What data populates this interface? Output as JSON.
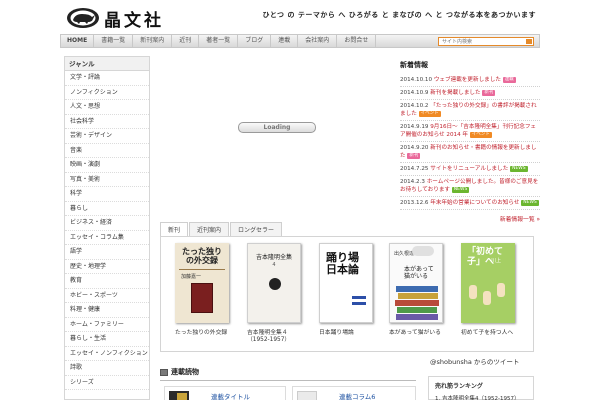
{
  "header": {
    "logo_text": "晶文社",
    "tagline": "ひとつ の テーマから へ ひろがる と まなびの へ と つながる本をあつかいます"
  },
  "nav": {
    "items": [
      "HOME",
      "書籍一覧",
      "新刊案内",
      "近刊",
      "著者一覧",
      "ブログ",
      "連載",
      "会社案内",
      "お問合せ"
    ]
  },
  "search": {
    "placeholder": "サイト内検索"
  },
  "sidebar": {
    "title": "ジャンル",
    "items": [
      "文学・評論",
      "ノンフィクション",
      "人文・思想",
      "社会科学",
      "芸術・デザイン",
      "音楽",
      "映画・演劇",
      "写真・美術",
      "科学",
      "暮らし",
      "ビジネス・経済",
      "エッセイ・コラム集",
      "語学",
      "歴史・地理学",
      "教育",
      "ホビー・スポーツ",
      "料理・健康",
      "ホーム・ファミリー",
      "暮らし・生活",
      "エッセイ・ノンフィクション",
      "詩歌",
      "シリーズ"
    ]
  },
  "slideshow": {
    "loading_label": "Loading"
  },
  "news": {
    "title": "新着情報",
    "items": [
      {
        "date": "2014.10.10",
        "text": "ウェブ連載を更新しました",
        "badge": "連載",
        "badge_style": "pink"
      },
      {
        "date": "2014.10.9",
        "text": "新刊を掲載しました",
        "badge": "新刊",
        "badge_style": "pink"
      },
      {
        "date": "2014.10.2",
        "text": "「たった独りの外交録」の書評が掲載されました",
        "badge": "イベント",
        "badge_style": "orange"
      },
      {
        "date": "2014.9.19",
        "text": "9月16日〜「吉本隆明全集」刊行記念フェア開催のお知らせ 2014 年",
        "badge": "イベント",
        "badge_style": "orange"
      },
      {
        "date": "2014.9.20",
        "text": "新刊のお知らせ・書籍の情報を更新しました",
        "badge": "新刊",
        "badge_style": "pink"
      },
      {
        "date": "2014.7.25",
        "text": "サイトをリニューアルしました",
        "badge": "NEWS",
        "badge_style": "new"
      },
      {
        "date": "2014.2.3",
        "text": "ホームページ公開しました。皆様のご意見をお待ちしております",
        "badge": "NEWS",
        "badge_style": "new"
      },
      {
        "date": "2013.12.6",
        "text": "年末年始の営業についてのお知らせ",
        "badge": "NEWS",
        "badge_style": "new"
      }
    ],
    "more_label": "新着情報一覧 »"
  },
  "tabs": {
    "items": [
      "新刊",
      "近刊案内",
      "ロングセラー"
    ]
  },
  "books": [
    {
      "title": "たった独りの外交録",
      "cover_title": "たった独りの外交録",
      "cover_author": "加藤嘉一"
    },
    {
      "title": "吉本隆明全集４（1952-1957）",
      "cover_title": "吉本隆明全集",
      "cover_author": "4"
    },
    {
      "title": "日本踊り場論",
      "cover_title": "踊り場 日本論",
      "cover_author": ""
    },
    {
      "title": "本があって猫がいる",
      "cover_title": "本があって 猫がいる",
      "cover_author": "出久根達郎"
    },
    {
      "title": "初めて子を持つ人へ",
      "cover_title": "「初めて子」へ",
      "cover_author": "川上"
    }
  ],
  "bottom": {
    "section_title": "連載読物",
    "cards": [
      {
        "link": "連載タイトル"
      },
      {
        "link": "連載コラム6"
      }
    ],
    "twitter_label": "@shobunsha からのツイート",
    "ranking_title": "売れ筋ランキング",
    "ranking_item": "1. 吉本隆明全集4（1952-1957）"
  },
  "colors": {
    "accent": "#c0202c",
    "search_border": "#e58a2a",
    "new_badge": "#6cb630"
  }
}
